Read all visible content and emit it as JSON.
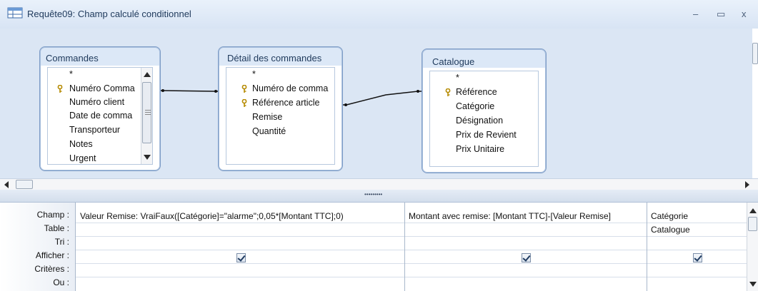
{
  "window": {
    "title": "Requête09: Champ calculé conditionnel",
    "minimize": "–",
    "maximize": "▭",
    "close": "x"
  },
  "tables": [
    {
      "name": "Commandes",
      "fields": [
        {
          "label": "*",
          "key": false
        },
        {
          "label": "Numéro Comma",
          "key": true
        },
        {
          "label": "Numéro client",
          "key": false
        },
        {
          "label": "Date de comma",
          "key": false
        },
        {
          "label": "Transporteur",
          "key": false
        },
        {
          "label": "Notes",
          "key": false
        },
        {
          "label": "Urgent",
          "key": false
        }
      ]
    },
    {
      "name": "Détail des commandes",
      "fields": [
        {
          "label": "*",
          "key": false
        },
        {
          "label": "Numéro de comma",
          "key": true
        },
        {
          "label": "Référence article",
          "key": true
        },
        {
          "label": "Remise",
          "key": false
        },
        {
          "label": "Quantité",
          "key": false
        }
      ]
    },
    {
      "name": "Catalogue",
      "fields": [
        {
          "label": "*",
          "key": false
        },
        {
          "label": "Référence",
          "key": true
        },
        {
          "label": "Catégorie",
          "key": false
        },
        {
          "label": "Désignation",
          "key": false
        },
        {
          "label": "Prix de Revient",
          "key": false
        },
        {
          "label": "Prix Unitaire",
          "key": false
        }
      ]
    }
  ],
  "grid": {
    "row_labels": [
      "Champ :",
      "Table :",
      "Tri :",
      "Afficher :",
      "Critères :",
      "Ou :"
    ],
    "columns": [
      {
        "champ": "Valeur Remise: VraiFaux([Catégorie]=\"alarme\";0,05*[Montant TTC];0)",
        "table": "",
        "afficher": true
      },
      {
        "champ": "Montant avec remise: [Montant TTC]-[Valeur Remise]",
        "table": "",
        "afficher": true
      },
      {
        "champ": "Catégorie",
        "table": "Catalogue",
        "afficher": true
      }
    ]
  },
  "splitter": {
    "handle": "•••••••••"
  },
  "colors": {
    "diagram_bg": "#dbe6f4",
    "title_text": "#1e395b"
  }
}
